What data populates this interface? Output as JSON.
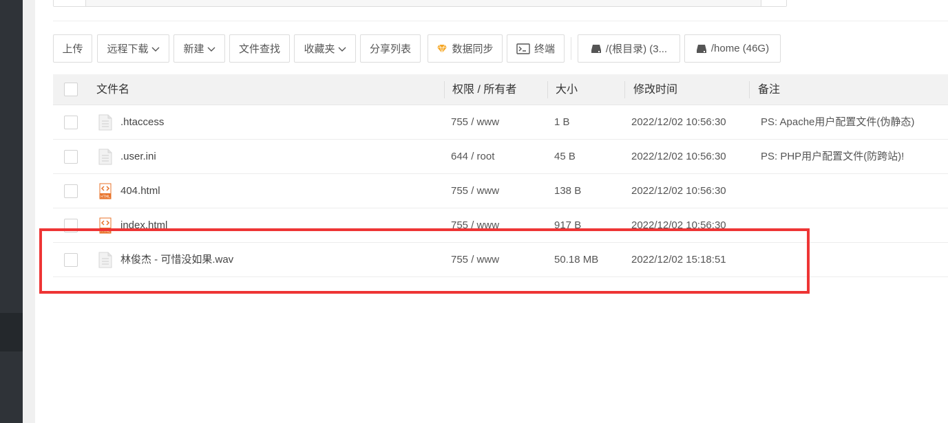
{
  "toolbar": {
    "upload": "上传",
    "remote_download": "远程下载",
    "new": "新建",
    "file_search": "文件查找",
    "favorites": "收藏夹",
    "share_list": "分享列表",
    "data_sync": "数据同步",
    "terminal": "终端",
    "disk_root": "/(根目录) (3...",
    "disk_home": "/home (46G)"
  },
  "table": {
    "headers": {
      "name": "文件名",
      "perm": "权限 / 所有者",
      "size": "大小",
      "mtime": "修改时间",
      "note": "备注"
    },
    "rows": [
      {
        "name": ".htaccess",
        "perm": "755 / www",
        "size": "1 B",
        "mtime": "2022/12/02 10:56:30",
        "note": "PS: Apache用户配置文件(伪静态)",
        "icon": "file-icon"
      },
      {
        "name": ".user.ini",
        "perm": "644 / root",
        "size": "45 B",
        "mtime": "2022/12/02 10:56:30",
        "note": "PS: PHP用户配置文件(防跨站)!",
        "icon": "file-icon"
      },
      {
        "name": "404.html",
        "perm": "755 / www",
        "size": "138 B",
        "mtime": "2022/12/02 10:56:30",
        "note": "",
        "icon": "html-file-icon"
      },
      {
        "name": "index.html",
        "perm": "755 / www",
        "size": "917 B",
        "mtime": "2022/12/02 10:56:30",
        "note": "",
        "icon": "html-file-icon"
      },
      {
        "name": "林俊杰 - 可惜没如果.wav",
        "perm": "755 / www",
        "size": "50.18 MB",
        "mtime": "2022/12/02 15:18:51",
        "note": "",
        "icon": "file-icon"
      }
    ]
  },
  "colors": {
    "highlight": "#ee3535",
    "html_icon": "#e8732a",
    "sidebar": "#2f3338",
    "diamond": "#f5a623"
  }
}
